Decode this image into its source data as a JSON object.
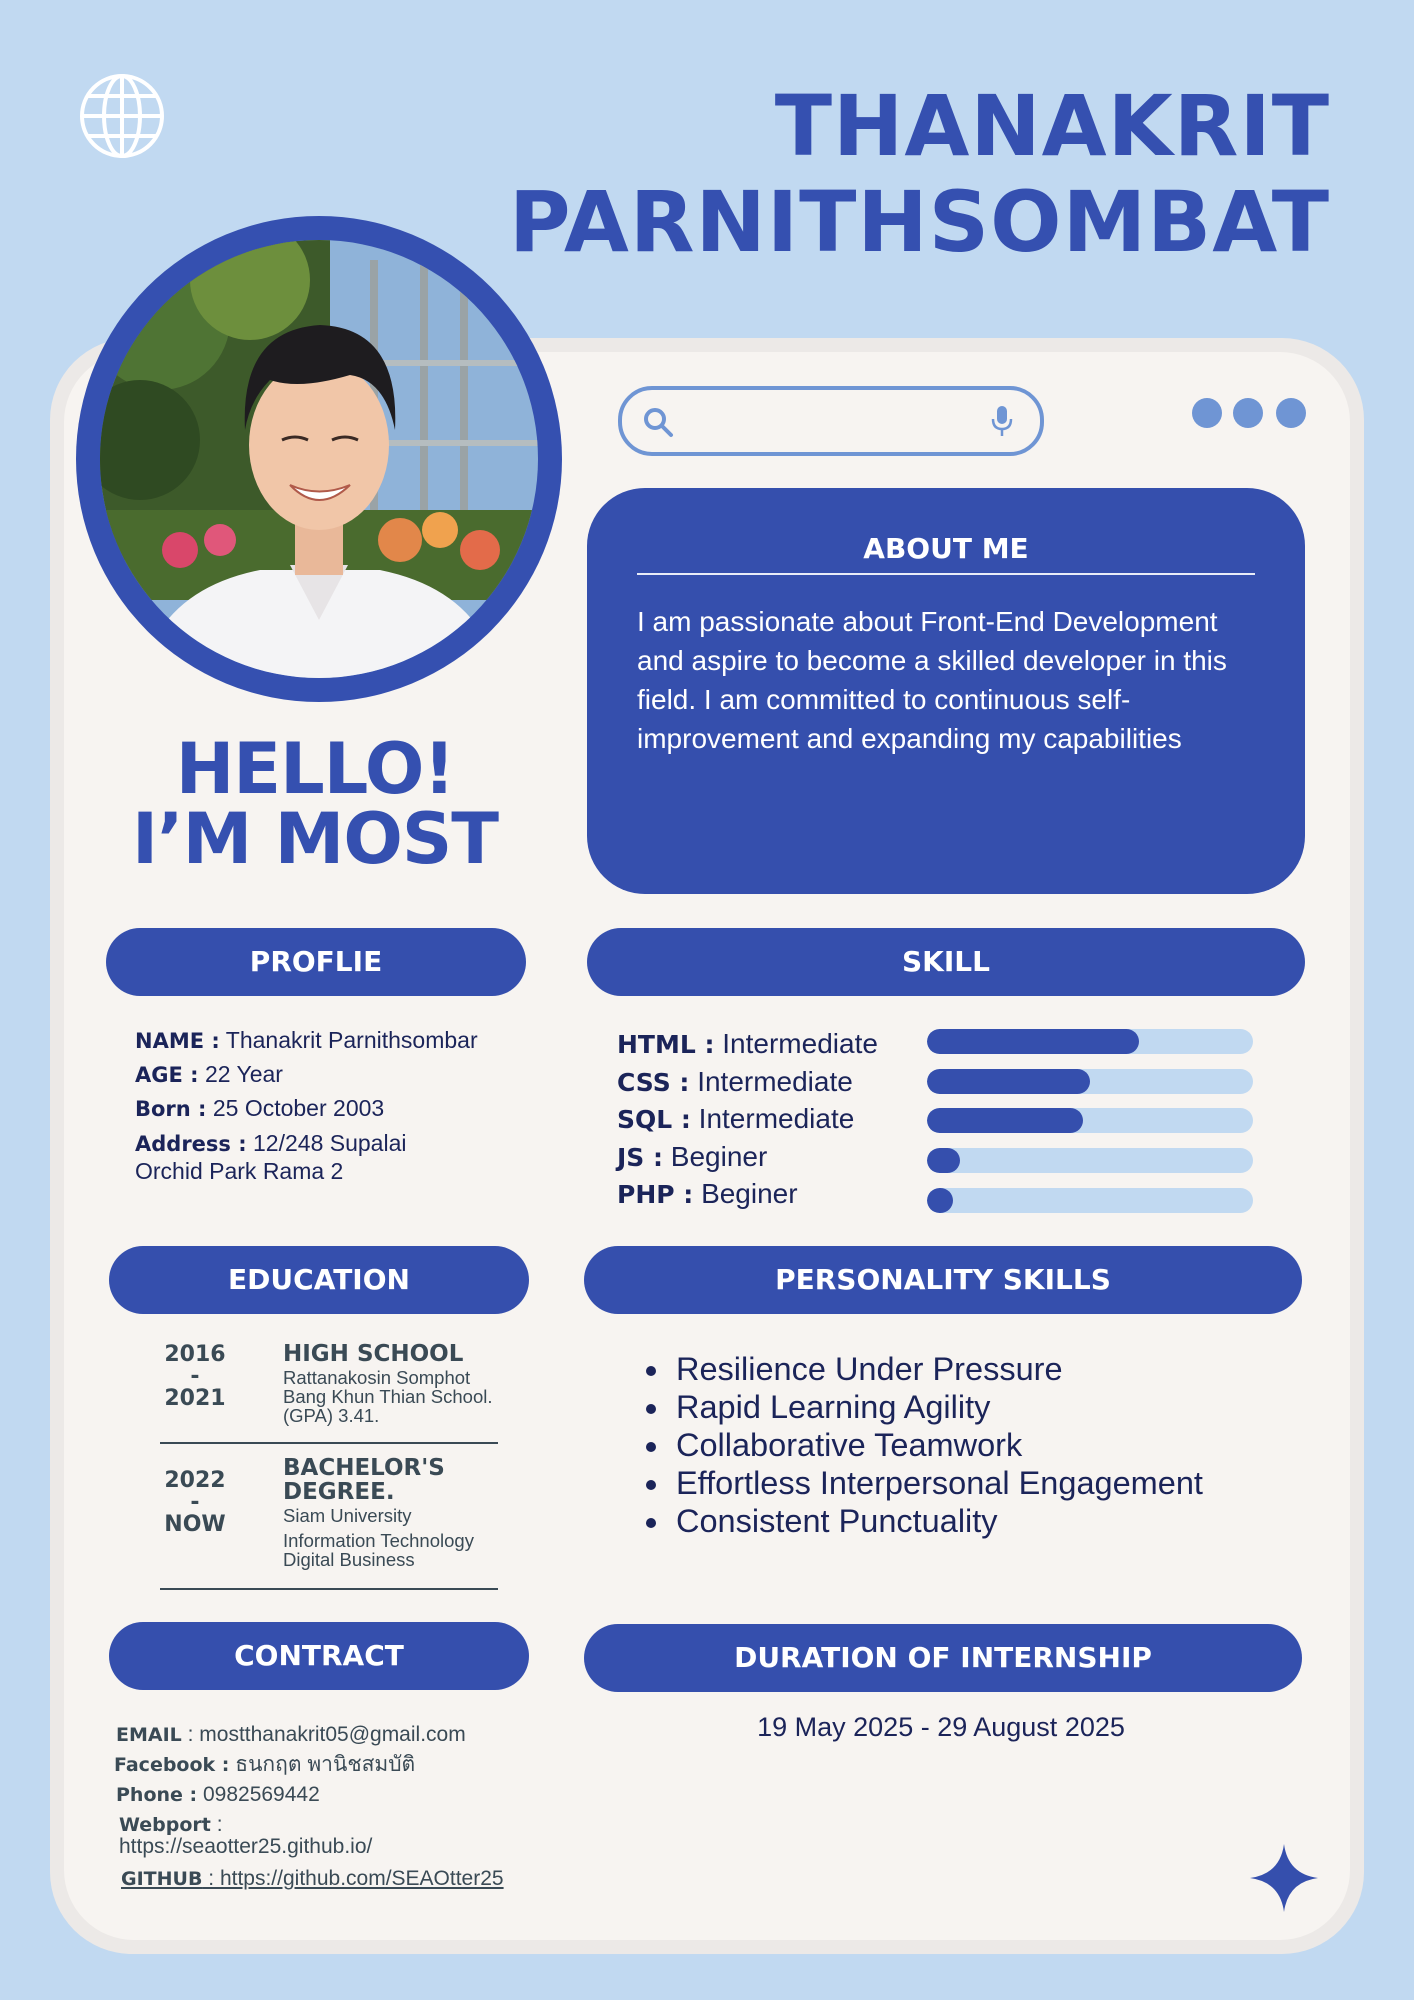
{
  "header": {
    "globe_icon": "globe-icon",
    "name_line1": "THANAKRIT",
    "name_line2": "PARNITHSOMBAT"
  },
  "photo": {
    "description_icon": "profile-photo"
  },
  "search": {
    "search_icon": "search-icon",
    "mic_icon": "microphone-icon",
    "value": ""
  },
  "window_dots": {
    "count": 3,
    "color": "#6f95d4"
  },
  "greeting": {
    "line1": "HELLO!",
    "line2": "I’M MOST"
  },
  "about": {
    "title": "ABOUT ME",
    "body": " I am passionate about Front-End Development and aspire to become a skilled developer in this field. I am committed to continuous self-improvement and expanding my capabilities"
  },
  "profile": {
    "title": "PROFLIE",
    "name_label": "NAME :",
    "name_value": "Thanakrit Parnithsombar",
    "age_label": "AGE :",
    "age_value": "22 Year",
    "born_label": "Born :",
    "born_value": "25 October 2003",
    "address_label": "Address :",
    "address_value_line1": "12/248 Supalai",
    "address_value_line2": "Orchid Park Rama 2"
  },
  "skill": {
    "title": "SKILL",
    "items": [
      {
        "name": "HTML :",
        "level": "Intermediate",
        "fill": 0.65
      },
      {
        "name": "CSS :",
        "level": "Intermediate",
        "fill": 0.5
      },
      {
        "name": "SQL :",
        "level": "Intermediate",
        "fill": 0.48
      },
      {
        "name": "JS :",
        "level": "Beginer",
        "fill": 0.1
      },
      {
        "name": "PHP :",
        "level": "Beginer",
        "fill": 0.08
      }
    ]
  },
  "education": {
    "title": "EDUCATION",
    "entries": [
      {
        "year_start": "2016",
        "dash": "-",
        "year_end": "2021",
        "title": "HIGH SCHOOL",
        "detail_line1": "Rattanakosin Somphot",
        "detail_line2": "Bang Khun Thian School.",
        "detail_line3": "(GPA) 3.41."
      },
      {
        "year_start": "2022",
        "dash": "-",
        "year_end": "NOW",
        "title_line1": "BACHELOR'S",
        "title_line2": "DEGREE.",
        "detail_line1": "Siam University",
        "detail_line2": "Information Technology",
        "detail_line3": "Digital Business"
      }
    ]
  },
  "personality": {
    "title": "PERSONALITY SKILLS",
    "items": [
      "Resilience Under Pressure",
      "Rapid Learning Agility",
      "Collaborative Teamwork",
      "Effortless Interpersonal Engagement",
      "Consistent Punctuality"
    ]
  },
  "contact": {
    "title": "CONTRACT",
    "email_label": "EMAIL",
    "email_value": " : mostthanakrit05@gmail.com",
    "facebook_label": "Facebook :",
    "facebook_value": "ธนกฤต พานิชสมบัติ",
    "phone_label": "Phone :",
    "phone_value": "0982569442",
    "webport_label": "Webport",
    "webport_sep": " :",
    "webport_url": "https://seaotter25.github.io/",
    "github_label": "GITHUB",
    "github_value": " : https://github.com/SEAOtter25"
  },
  "internship": {
    "title": "DURATION OF INTERNSHIP",
    "dates": "19 May 2025 - 29 August 2025"
  },
  "decor": {
    "sparkle_icon": "sparkle-icon"
  },
  "colors": {
    "background": "#c1d9f1",
    "accent": "#354fad",
    "title": "#3550b0",
    "card": "#f7f4f1"
  }
}
